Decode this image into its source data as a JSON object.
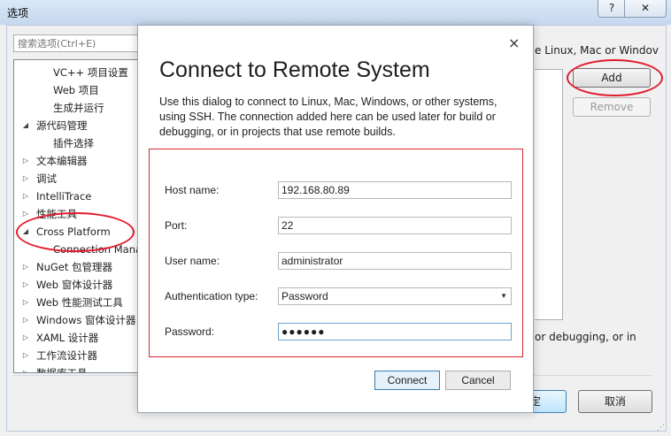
{
  "window": {
    "title": "选项",
    "help_glyph": "?",
    "close_glyph": "✕"
  },
  "search": {
    "placeholder": "搜索选项(Ctrl+E)"
  },
  "tree": {
    "items": [
      {
        "label": "VC++ 项目设置",
        "arrow": ""
      },
      {
        "label": "Web 项目",
        "arrow": ""
      },
      {
        "label": "生成并运行",
        "arrow": ""
      },
      {
        "label": "源代码管理",
        "arrow": "◢"
      },
      {
        "label": "插件选择",
        "arrow": ""
      },
      {
        "label": "文本编辑器",
        "arrow": "▷"
      },
      {
        "label": "调试",
        "arrow": "▷"
      },
      {
        "label": "IntelliTrace",
        "arrow": "▷"
      },
      {
        "label": "性能工具",
        "arrow": "▷"
      },
      {
        "label": "Cross Platform",
        "arrow": "◢"
      },
      {
        "label": "Connection Manager",
        "arrow": ""
      },
      {
        "label": "NuGet 包管理器",
        "arrow": "▷"
      },
      {
        "label": "Web 窗体设计器",
        "arrow": "▷"
      },
      {
        "label": "Web 性能测试工具",
        "arrow": "▷"
      },
      {
        "label": "Windows 窗体设计器",
        "arrow": "▷"
      },
      {
        "label": "XAML 设计器",
        "arrow": "▷"
      },
      {
        "label": "工作流设计器",
        "arrow": "▷"
      },
      {
        "label": "数据库工具",
        "arrow": "▷"
      }
    ]
  },
  "right_panel": {
    "label": "e Linux, Mac or Windov",
    "add_label": "Add",
    "remove_label": "Remove",
    "desc": "or debugging, or in"
  },
  "footer": {
    "ok_label": "定",
    "cancel_label": "取消"
  },
  "dialog": {
    "close_glyph": "×",
    "title": "Connect to Remote System",
    "description": "Use this dialog to connect to Linux, Mac, Windows, or other systems, using SSH. The connection added here can be used later for build or debugging, or in projects that use remote builds.",
    "fields": {
      "host": {
        "label": "Host name:",
        "value": "192.168.80.89"
      },
      "port": {
        "label": "Port:",
        "value": "22"
      },
      "user": {
        "label": "User name:",
        "value": "administrator"
      },
      "auth": {
        "label": "Authentication type:",
        "value": "Password"
      },
      "password": {
        "label": "Password:",
        "value": "●●●●●●"
      }
    },
    "connect_label": "Connect",
    "cancel_label": "Cancel"
  },
  "colors": {
    "annotation_red": "#e21b2f",
    "form_border": "#d3262e"
  }
}
